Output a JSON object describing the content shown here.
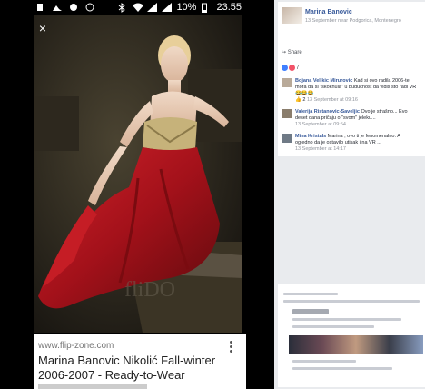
{
  "status_bar": {
    "battery": "10%",
    "time": "23.55",
    "icons": [
      "notification-icon",
      "image-icon",
      "chat-icon",
      "bluetooth-icon",
      "wifi-icon",
      "signal-icon",
      "battery-icon"
    ]
  },
  "viewer": {
    "close_icon": "×",
    "domain": "www.flip-zone.com",
    "title": "Marina Banovic Nikolić Fall-winter 2006-2007 - Ready-to-Wear"
  },
  "facebook": {
    "post": {
      "author": "Marina Banovic",
      "meta": "13 September near Podgorica, Montenegro",
      "share_label": "Share",
      "reaction_count": "7"
    },
    "comments": [
      {
        "name": "Bojana Velikic Mirurovic",
        "text": "Kad si ovo radila 2006-te, mora da si \"skoknula\" u budućnost da vidiš što radi VR 😂😂😂",
        "likes": "2",
        "time": "13 September at 09:16"
      },
      {
        "name": "Valerija Ristanovic-Saveljic",
        "text": "Ovo je strašno... Evo deset dana pričaju o \"svom\" jeleku...",
        "time": "13 September at 09:54"
      },
      {
        "name": "Mina Kristals",
        "text": "Marina , ovo ti je fenomenalno. A ogledno da je ostavilo utisak i na VR ...",
        "time": "13 September at 14:17"
      }
    ]
  },
  "colors": {
    "fb_blue": "#365899",
    "fb_bg": "#e9ebee",
    "dress_red": "#b0141a"
  }
}
